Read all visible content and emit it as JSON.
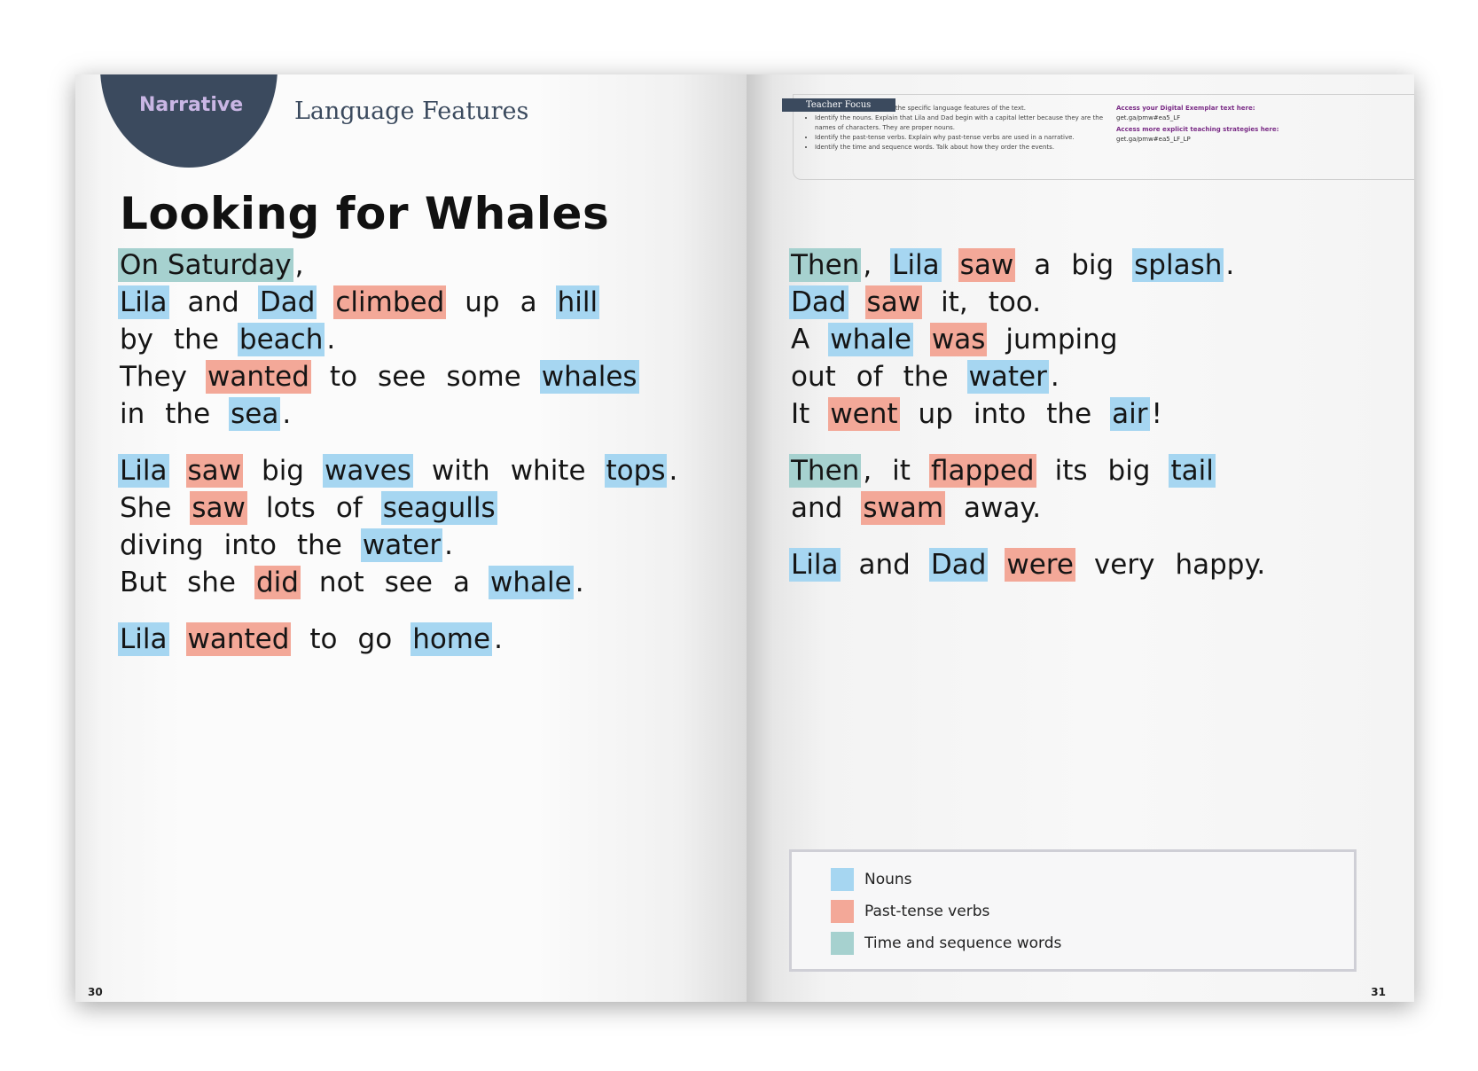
{
  "header": {
    "badge": "Narrative",
    "section": "Language Features"
  },
  "story": {
    "title": "Looking for Whales",
    "left_lines": [
      [
        {
          "w": "On  Saturday",
          "c": "t",
          "tight": true
        },
        {
          "w": ",",
          "c": ""
        }
      ],
      [
        {
          "w": "Lila",
          "c": "n"
        },
        {
          "w": "and",
          "c": ""
        },
        {
          "w": "Dad",
          "c": "n"
        },
        {
          "w": "climbed",
          "c": "v"
        },
        {
          "w": "up",
          "c": ""
        },
        {
          "w": "a",
          "c": ""
        },
        {
          "w": "hill",
          "c": "n"
        }
      ],
      [
        {
          "w": "by",
          "c": ""
        },
        {
          "w": "the",
          "c": ""
        },
        {
          "w": "beach",
          "c": "n",
          "tight": true
        },
        {
          "w": ".",
          "c": ""
        }
      ],
      [
        {
          "w": "They",
          "c": ""
        },
        {
          "w": "wanted",
          "c": "v"
        },
        {
          "w": "to",
          "c": ""
        },
        {
          "w": "see",
          "c": ""
        },
        {
          "w": "some",
          "c": ""
        },
        {
          "w": "whales",
          "c": "n"
        }
      ],
      [
        {
          "w": "in",
          "c": ""
        },
        {
          "w": "the",
          "c": ""
        },
        {
          "w": "sea",
          "c": "n",
          "tight": true
        },
        {
          "w": ".",
          "c": ""
        }
      ],
      [
        {
          "w": "Lila",
          "c": "n"
        },
        {
          "w": "saw",
          "c": "v"
        },
        {
          "w": "big",
          "c": ""
        },
        {
          "w": "waves",
          "c": "n"
        },
        {
          "w": "with",
          "c": ""
        },
        {
          "w": "white",
          "c": ""
        },
        {
          "w": "tops",
          "c": "n",
          "tight": true
        },
        {
          "w": ".",
          "c": ""
        }
      ],
      [
        {
          "w": "She",
          "c": ""
        },
        {
          "w": "saw",
          "c": "v"
        },
        {
          "w": "lots",
          "c": ""
        },
        {
          "w": "of",
          "c": ""
        },
        {
          "w": "seagulls",
          "c": "n"
        }
      ],
      [
        {
          "w": "diving",
          "c": ""
        },
        {
          "w": "into",
          "c": ""
        },
        {
          "w": "the",
          "c": ""
        },
        {
          "w": "water",
          "c": "n",
          "tight": true
        },
        {
          "w": ".",
          "c": ""
        }
      ],
      [
        {
          "w": "But",
          "c": ""
        },
        {
          "w": "she",
          "c": ""
        },
        {
          "w": "did",
          "c": "v"
        },
        {
          "w": "not",
          "c": ""
        },
        {
          "w": "see",
          "c": ""
        },
        {
          "w": "a",
          "c": ""
        },
        {
          "w": "whale",
          "c": "n",
          "tight": true
        },
        {
          "w": ".",
          "c": ""
        }
      ],
      [
        {
          "w": "Lila",
          "c": "n"
        },
        {
          "w": "wanted",
          "c": "v"
        },
        {
          "w": "to",
          "c": ""
        },
        {
          "w": "go",
          "c": ""
        },
        {
          "w": "home",
          "c": "n",
          "tight": true
        },
        {
          "w": ".",
          "c": ""
        }
      ]
    ],
    "right_lines": [
      [
        {
          "w": "Then",
          "c": "t",
          "tight": true
        },
        {
          "w": ",",
          "c": ""
        },
        {
          "w": "Lila",
          "c": "n"
        },
        {
          "w": "saw",
          "c": "v"
        },
        {
          "w": "a",
          "c": ""
        },
        {
          "w": "big",
          "c": ""
        },
        {
          "w": "splash",
          "c": "n",
          "tight": true
        },
        {
          "w": ".",
          "c": ""
        }
      ],
      [
        {
          "w": "Dad",
          "c": "n"
        },
        {
          "w": "saw",
          "c": "v"
        },
        {
          "w": "it,",
          "c": ""
        },
        {
          "w": "too.",
          "c": ""
        }
      ],
      [
        {
          "w": "A",
          "c": ""
        },
        {
          "w": "whale",
          "c": "n"
        },
        {
          "w": "was",
          "c": "v"
        },
        {
          "w": "jumping",
          "c": ""
        }
      ],
      [
        {
          "w": "out",
          "c": ""
        },
        {
          "w": "of",
          "c": ""
        },
        {
          "w": "the",
          "c": ""
        },
        {
          "w": "water",
          "c": "n",
          "tight": true
        },
        {
          "w": ".",
          "c": ""
        }
      ],
      [
        {
          "w": "It",
          "c": ""
        },
        {
          "w": "went",
          "c": "v"
        },
        {
          "w": "up",
          "c": ""
        },
        {
          "w": "into",
          "c": ""
        },
        {
          "w": "the",
          "c": ""
        },
        {
          "w": "air",
          "c": "n",
          "tight": true
        },
        {
          "w": "!",
          "c": ""
        }
      ],
      [
        {
          "w": "Then",
          "c": "t",
          "tight": true
        },
        {
          "w": ",",
          "c": ""
        },
        {
          "w": "it",
          "c": ""
        },
        {
          "w": "flapped",
          "c": "v"
        },
        {
          "w": "its",
          "c": ""
        },
        {
          "w": "big",
          "c": ""
        },
        {
          "w": "tail",
          "c": "n"
        }
      ],
      [
        {
          "w": "and",
          "c": ""
        },
        {
          "w": "swam",
          "c": "v"
        },
        {
          "w": "away.",
          "c": ""
        }
      ],
      [
        {
          "w": "Lila",
          "c": "n"
        },
        {
          "w": "and",
          "c": ""
        },
        {
          "w": "Dad",
          "c": "n"
        },
        {
          "w": "were",
          "c": "v"
        },
        {
          "w": "very",
          "c": ""
        },
        {
          "w": "happy.",
          "c": ""
        }
      ]
    ]
  },
  "teacher_focus": {
    "tab": "Teacher Focus",
    "intro": "Focus students' attention on the specific language features of the text.",
    "bullets": [
      "Identify the nouns. Explain that Lila and Dad begin with a capital letter because they are the names of characters. They are proper nouns.",
      "Identify the past-tense verbs. Explain why past-tense verbs are used in a narrative.",
      "Identify the time and sequence words. Talk about how they order the events."
    ],
    "link1_label": "Access your Digital Exemplar text here:",
    "link1_url": "get.ga/pmw#ea5_LF",
    "link2_label": "Access more explicit teaching strategies here:",
    "link2_url": "get.ga/pmw#ea5_LF_LP"
  },
  "legend": [
    {
      "label": "Nouns",
      "color": "#a6d6f1"
    },
    {
      "label": "Past-tense verbs",
      "color": "#f3a898"
    },
    {
      "label": "Time and sequence words",
      "color": "#a6d1cf"
    }
  ],
  "pages": {
    "left": "30",
    "right": "31"
  }
}
